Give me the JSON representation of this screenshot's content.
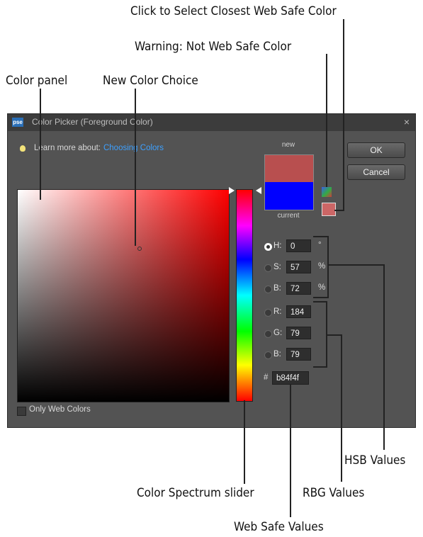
{
  "callouts": {
    "websafe_select": "Click to Select Closest Web Safe Color",
    "warning": "Warning: Not Web Safe Color",
    "color_panel": "Color panel",
    "new_color": "New Color Choice",
    "hsb_values": "HSB Values",
    "spectrum": "Color Spectrum slider",
    "rbg_values": "RBG Values",
    "web_safe_values": "Web Safe Values"
  },
  "dialog": {
    "app_icon_text": "pse",
    "title": "Color Picker (Foreground Color)",
    "close": "×",
    "learn_prefix": "Learn more about:",
    "learn_link": "Choosing Colors",
    "ok": "OK",
    "cancel": "Cancel",
    "new_label": "new",
    "current_label": "current",
    "only_web_colors": "Only Web Colors",
    "hex_prefix": "#",
    "hex_value": "b84f4f"
  },
  "fields": {
    "h": {
      "label": "H:",
      "value": "0",
      "unit": "°"
    },
    "s": {
      "label": "S:",
      "value": "57",
      "unit": "%"
    },
    "bri": {
      "label": "B:",
      "value": "72",
      "unit": "%"
    },
    "r": {
      "label": "R:",
      "value": "184"
    },
    "g": {
      "label": "G:",
      "value": "79"
    },
    "b": {
      "label": "B:",
      "value": "79"
    }
  },
  "colors": {
    "new": "#b84f4f",
    "current": "#0000ff",
    "web_safe": "#cc6666",
    "link": "#3da0ff"
  },
  "icons": {
    "warning": "cube-warning-icon",
    "hint": "lightbulb-icon"
  }
}
